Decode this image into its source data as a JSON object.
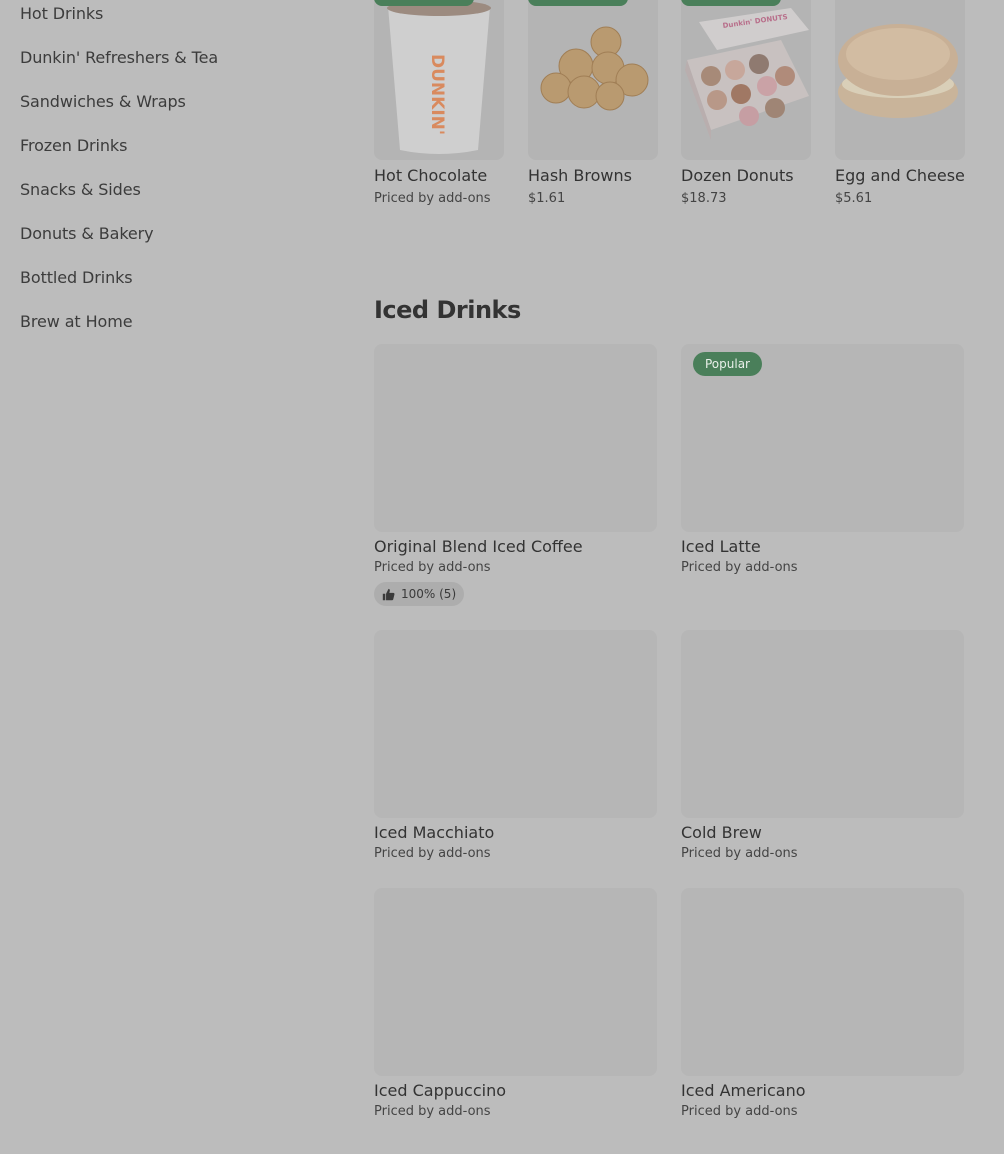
{
  "sidebar": {
    "items": [
      {
        "label": "Hot Drinks"
      },
      {
        "label": "Dunkin' Refreshers & Tea"
      },
      {
        "label": "Sandwiches & Wraps"
      },
      {
        "label": "Frozen Drinks"
      },
      {
        "label": "Snacks & Sides"
      },
      {
        "label": "Donuts & Bakery"
      },
      {
        "label": "Bottled Drinks"
      },
      {
        "label": "Brew at Home"
      }
    ]
  },
  "top_row": [
    {
      "name": "Hot Chocolate",
      "price": "Priced by add-ons",
      "image_icon": "hot-chocolate-cup"
    },
    {
      "name": "Hash Browns",
      "price": "$1.61",
      "image_icon": "hash-browns"
    },
    {
      "name": "Dozen Donuts",
      "price": "$18.73",
      "image_icon": "donut-box",
      "box_text": "Dunkin' DONUTS"
    },
    {
      "name": "Egg and Cheese",
      "price": "$5.61",
      "image_icon": "egg-and-cheese-sandwich"
    }
  ],
  "iced_section": {
    "title": "Iced Drinks",
    "items": [
      {
        "name": "Original Blend Iced Coffee",
        "price": "Priced by add-ons",
        "rating": "100% (5)"
      },
      {
        "name": "Iced Latte",
        "price": "Priced by add-ons",
        "badge": "Popular"
      },
      {
        "name": "Iced Macchiato",
        "price": "Priced by add-ons"
      },
      {
        "name": "Cold Brew",
        "price": "Priced by add-ons"
      },
      {
        "name": "Iced Cappuccino",
        "price": "Priced by add-ons"
      },
      {
        "name": "Iced Americano",
        "price": "Priced by add-ons"
      }
    ]
  },
  "cup_text": "DUNKIN'",
  "colors": {
    "overlay_bg": "#bcbcbc",
    "badge_green": "#4a7f5a",
    "cup_orange": "#d98a5e"
  }
}
